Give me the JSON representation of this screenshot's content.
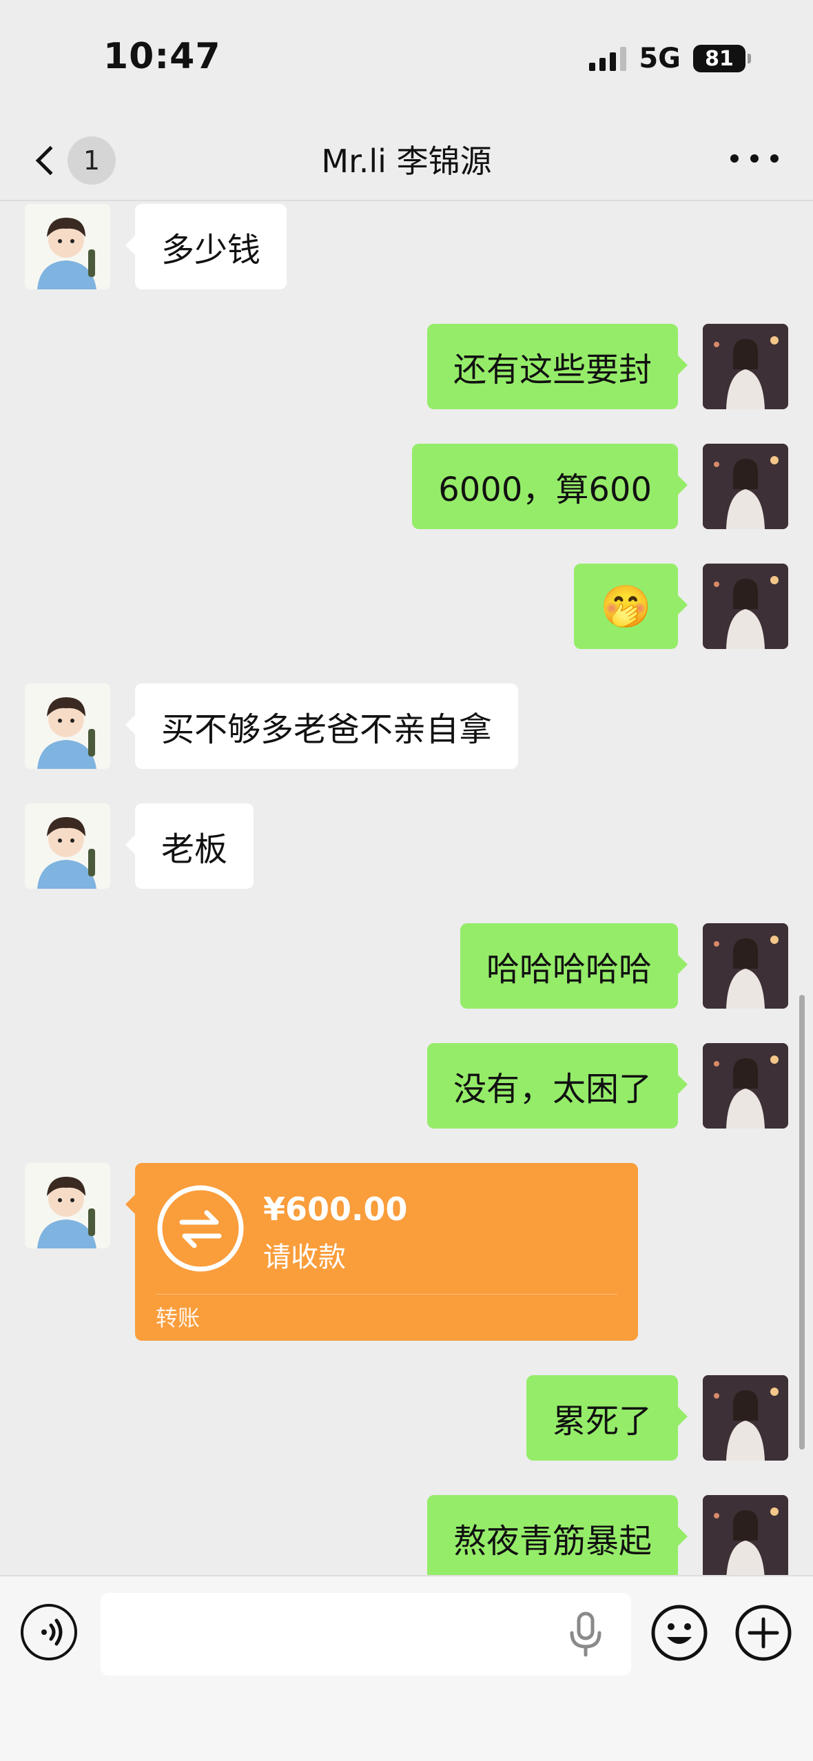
{
  "status_bar": {
    "time": "10:47",
    "network": "5G",
    "battery": "81"
  },
  "nav": {
    "unread_count": "1",
    "title": "Mr.li 李锦源"
  },
  "messages": [
    {
      "side": "left",
      "text": "多少钱"
    },
    {
      "side": "right",
      "text": "还有这些要封"
    },
    {
      "side": "right",
      "text": "6000，算600"
    },
    {
      "side": "right",
      "text": "🤭"
    },
    {
      "side": "left",
      "text": "买不够多老爸不亲自拿"
    },
    {
      "side": "left",
      "text": "老板"
    },
    {
      "side": "right",
      "text": "哈哈哈哈哈"
    },
    {
      "side": "right",
      "text": "没有，太困了"
    },
    {
      "side": "left",
      "type": "transfer",
      "amount": "¥600.00",
      "status": "请收款",
      "label": "转账"
    },
    {
      "side": "right",
      "text": "累死了"
    },
    {
      "side": "right",
      "text": "熬夜青筋暴起"
    }
  ],
  "input_bar": {
    "placeholder": ""
  },
  "colors": {
    "sent_bubble": "#95ec69",
    "received_bubble": "#ffffff",
    "transfer": "#fa9d3b",
    "background": "#ededed"
  }
}
